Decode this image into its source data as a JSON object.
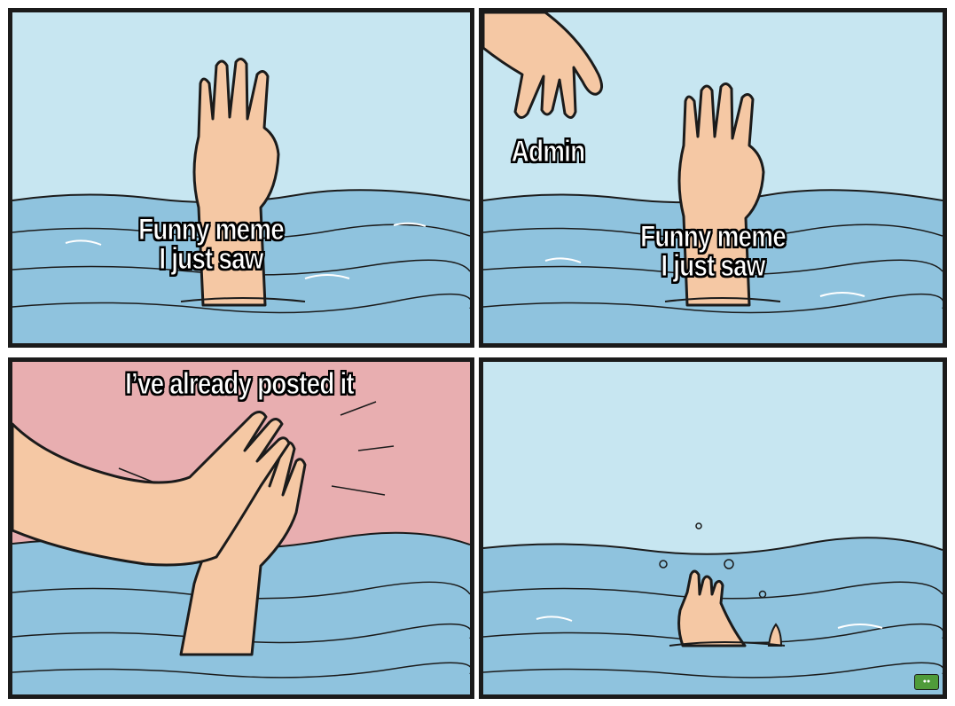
{
  "meme": {
    "panel1": {
      "caption_line1": "Funny meme",
      "caption_line2": "I just saw"
    },
    "panel2": {
      "admin_label": "Admin",
      "caption_line1": "Funny meme",
      "caption_line2": "I just saw"
    },
    "panel3": {
      "caption": "I’ve already posted it"
    }
  },
  "colors": {
    "sky": "#c7e6f1",
    "water": "#8fc3de",
    "water_dark": "#6aa8cc",
    "skin": "#f5c8a4",
    "pink_bg": "#e8aeb0",
    "outline": "#1b1b1b"
  },
  "icons": {
    "watermark": "brand-badge-icon"
  }
}
